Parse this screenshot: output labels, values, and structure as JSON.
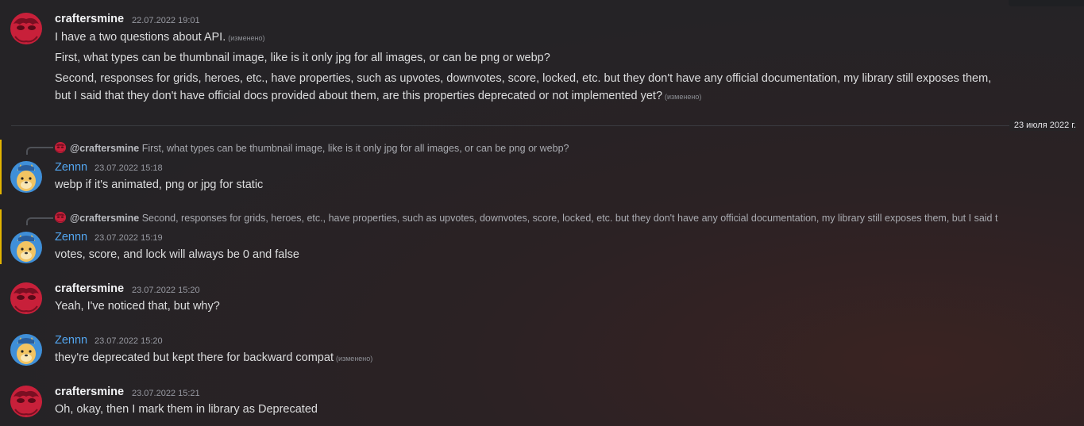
{
  "date_divider": "23 июля 2022 г.",
  "edited_label": "(изменено)",
  "messages": [
    {
      "author": "craftersmine",
      "time": "22.07.2022 19:01",
      "lines": [
        "I have a two questions about API.",
        "First, what types can be thumbnail image, like is it only jpg for all images, or can be png or webp?",
        "Second, responses for grids, heroes, etc., have properties, such as upvotes, downvotes, score, locked, etc. but they don't have any official documentation, my library still exposes them,",
        "but I said that they don't have official docs provided about them, are this properties deprecated or not implemented yet?"
      ]
    },
    {
      "reply_to": "@craftersmine",
      "reply_text": "First, what types can be thumbnail image, like is it only jpg for all images, or can be png or webp?",
      "author": "Zennn",
      "time": "23.07.2022 15:18",
      "lines": [
        "webp if it's animated, png or jpg for static"
      ]
    },
    {
      "reply_to": "@craftersmine",
      "reply_text": "Second, responses for grids, heroes, etc., have properties, such as upvotes, downvotes, score, locked, etc. but they don't have any official documentation, my library still exposes them, but I said t",
      "author": "Zennn",
      "time": "23.07.2022 15:19",
      "lines": [
        "votes, score, and lock will always be 0 and false"
      ]
    },
    {
      "author": "craftersmine",
      "time": "23.07.2022 15:20",
      "lines": [
        "Yeah, I've noticed that, but why?"
      ]
    },
    {
      "author": "Zennn",
      "time": "23.07.2022 15:20",
      "lines": [
        "they're deprecated but kept there for backward compat"
      ]
    },
    {
      "author": "craftersmine",
      "time": "23.07.2022 15:21",
      "lines": [
        "Oh, okay, then I mark them in library as Deprecated"
      ]
    }
  ],
  "colors": {
    "craftersmine_name": "#f2f3f5",
    "zennn_name": "#53a6f0",
    "mention_highlight": "#e3b400"
  }
}
